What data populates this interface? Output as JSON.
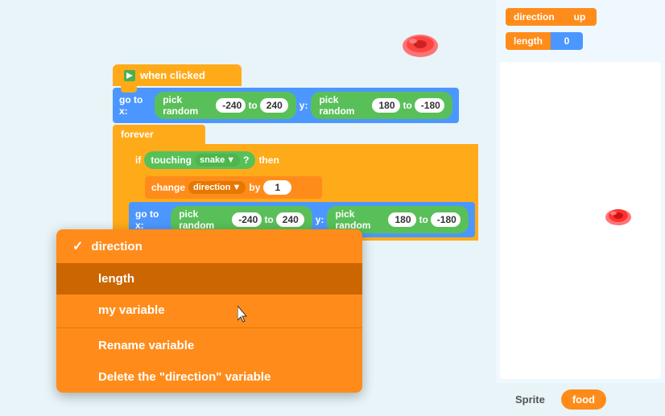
{
  "monitors": {
    "direction": {
      "label": "direction",
      "value": "up",
      "value_color": "#ff8c1a"
    },
    "length": {
      "label": "length",
      "value": "0",
      "value_color": "#4c97ff"
    }
  },
  "blocks": {
    "when_clicked": "when clicked",
    "goto": "go to x:",
    "pick_random": "pick random",
    "to": "to",
    "y_label": "y:",
    "forever": "forever",
    "if_label": "if",
    "then": "then",
    "touching": "touching",
    "snake": "snake",
    "question_mark": "?",
    "change": "change",
    "direction_var": "direction",
    "by": "by",
    "value_neg240": "-240",
    "value_240": "240",
    "value_180": "180",
    "value_neg180": "-180",
    "value_1": "1"
  },
  "dropdown": {
    "items": [
      {
        "id": "direction",
        "label": "direction",
        "checked": true
      },
      {
        "id": "length",
        "label": "length",
        "checked": false,
        "active": true
      },
      {
        "id": "my_variable",
        "label": "my variable",
        "checked": false
      },
      {
        "id": "rename",
        "label": "Rename variable",
        "checked": false,
        "separator_before": true
      },
      {
        "id": "delete",
        "label": "Delete the \"direction\" variable",
        "checked": false
      }
    ]
  },
  "stage": {
    "bottom_tabs": [
      {
        "id": "sprite",
        "label": "Sprite",
        "active": false
      },
      {
        "id": "food",
        "label": "food",
        "active": true
      }
    ]
  }
}
